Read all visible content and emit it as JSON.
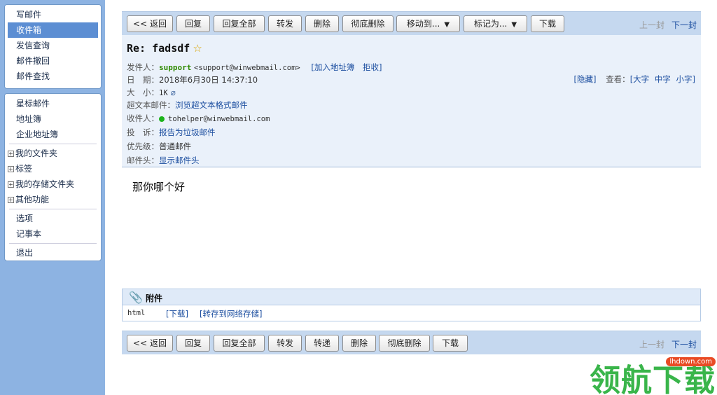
{
  "sidebar": {
    "panel1": [
      "写邮件",
      "收件箱",
      "发信查询",
      "邮件撤回",
      "邮件查找"
    ],
    "panel2_top": [
      "星标邮件",
      "地址簿",
      "企业地址簿"
    ],
    "folders": [
      "我的文件夹",
      "标签",
      "我的存储文件夹",
      "其他功能"
    ],
    "plus_symbol": "+",
    "panel2_mid": [
      "选项",
      "记事本"
    ],
    "logout": "退出"
  },
  "toolbar_top": {
    "back": "<< 返回",
    "reply": "回复",
    "reply_all": "回复全部",
    "forward": "转发",
    "delete": "删除",
    "perm_delete": "彻底删除",
    "move_to": "移动到...",
    "mark_as": "标记为...",
    "download": "下载",
    "caret": "▼",
    "prev": "上一封",
    "next": "下一封"
  },
  "toolbar_bottom": {
    "back": "<< 返回",
    "reply": "回复",
    "reply_all": "回复全部",
    "forward": "转发",
    "redirect": "转递",
    "delete": "删除",
    "perm_delete": "彻底删除",
    "download": "下载",
    "prev": "上一封",
    "next": "下一封"
  },
  "message": {
    "subject": "Re: fadsdf",
    "star": "☆",
    "sender_label": "发件人：",
    "sender_name": "support",
    "sender_email": "<support@winwebmail.com>",
    "add_contact": "[加入地址簿",
    "reject": "拒收]",
    "date_label": "日　期：",
    "date_value": "2018年6月30日 14:37:10",
    "size_label": "大　小：",
    "size_value": "1K",
    "clip": "⌀",
    "hide": "[隐藏]",
    "view_label": "查看：",
    "size_large": "[大字",
    "size_medium": "中字",
    "size_small": "小字]",
    "html_label": "超文本邮件：",
    "html_link": "浏览超文本格式邮件",
    "recipient_label": "收件人：",
    "recipient_email": "tohelper@winwebmail.com",
    "complain_label": "投　诉：",
    "complain_link": "报告为垃圾邮件",
    "priority_label": "优先级：",
    "priority_value": "普通邮件",
    "headers_label": "邮件头：",
    "headers_link": "显示邮件头",
    "body": "那你哪个好"
  },
  "attachments": {
    "title": "附件",
    "icon": "📎",
    "file_name": "html",
    "download": "[下载]",
    "save_net": "[转存到网络存储]"
  },
  "watermark": {
    "text": "领航下载",
    "badge": "lhdown.com"
  },
  "colors": {
    "sidebar_bg": "#8db3e2",
    "active_item": "#5c8ed3",
    "toolbar_bg": "#c5d8ef",
    "link": "#1d4fa0",
    "sender_green": "#2f8a00",
    "watermark_green": "#39b54a"
  }
}
